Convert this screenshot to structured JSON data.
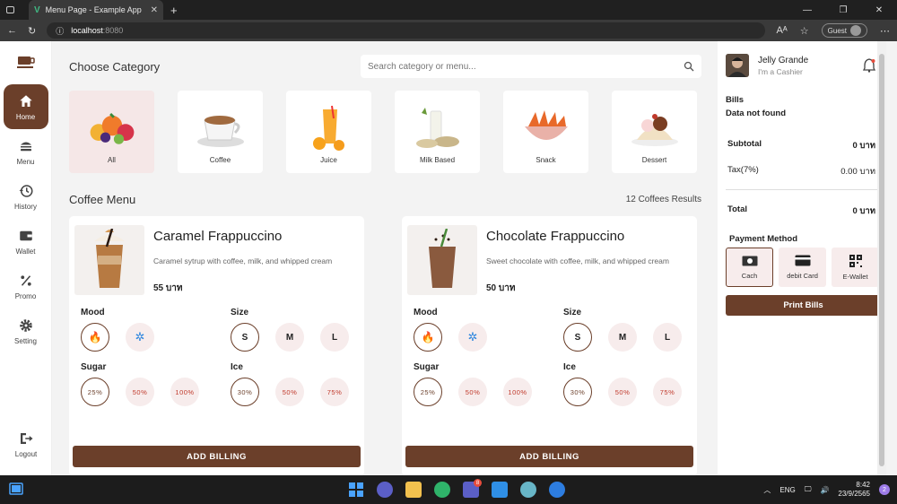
{
  "browser": {
    "tab_title": "Menu Page - Example App",
    "address_host": "localhost",
    "address_port": ":8080",
    "guest_label": "Guest"
  },
  "sidebar": {
    "items": [
      {
        "label": "Home",
        "icon": "home-icon"
      },
      {
        "label": "Menu",
        "icon": "burger-icon"
      },
      {
        "label": "History",
        "icon": "history-icon"
      },
      {
        "label": "Wallet",
        "icon": "wallet-icon"
      },
      {
        "label": "Promo",
        "icon": "percent-icon"
      },
      {
        "label": "Setting",
        "icon": "gear-icon"
      }
    ],
    "logout_label": "Logout"
  },
  "category": {
    "title": "Choose Category",
    "search_placeholder": "Search category or menu...",
    "items": [
      "All",
      "Coffee",
      "Juice",
      "Milk Based",
      "Snack",
      "Dessert"
    ]
  },
  "menu": {
    "title": "Coffee Menu",
    "results": "12 Coffees Results",
    "cards": [
      {
        "name": "Caramel Frappuccino",
        "desc": "Caramel sytrup with coffee, milk, and whipped cream",
        "price": "55 บาท",
        "mood_label": "Mood",
        "size_label": "Size",
        "sugar_label": "Sugar",
        "ice_label": "Ice",
        "sizes": [
          "S",
          "M",
          "L"
        ],
        "sugars": [
          "25%",
          "50%",
          "100%"
        ],
        "ices": [
          "30%",
          "50%",
          "75%"
        ],
        "button": "ADD BILLING"
      },
      {
        "name": "Chocolate Frappuccino",
        "desc": "Sweet chocolate with coffee, milk, and whipped cream",
        "price": "50 บาท",
        "mood_label": "Mood",
        "size_label": "Size",
        "sugar_label": "Sugar",
        "ice_label": "Ice",
        "sizes": [
          "S",
          "M",
          "L"
        ],
        "sugars": [
          "25%",
          "50%",
          "100%"
        ],
        "ices": [
          "30%",
          "50%",
          "75%"
        ],
        "button": "ADD BILLING"
      }
    ]
  },
  "bill": {
    "user_name": "Jelly Grande",
    "user_role": "I'm a Cashier",
    "bills_title": "Bills",
    "bills_empty": "Data not found",
    "subtotal_label": "Subtotal",
    "subtotal_value": "0 บาท",
    "tax_label": "Tax(7%)",
    "tax_value": "0.00 บาท",
    "total_label": "Total",
    "total_value": "0 บาท",
    "payment_title": "Payment Method",
    "payments": [
      "Cach",
      "debit Card",
      "E-Wallet"
    ],
    "print_button": "Print Bills"
  },
  "taskbar": {
    "lang": "ENG",
    "time": "8:42",
    "date": "23/9/2565",
    "notif_count": "2",
    "teams_badge": "8"
  },
  "colors": {
    "accent": "#6b3f2a",
    "selected_bg": "#f5e7e7"
  }
}
